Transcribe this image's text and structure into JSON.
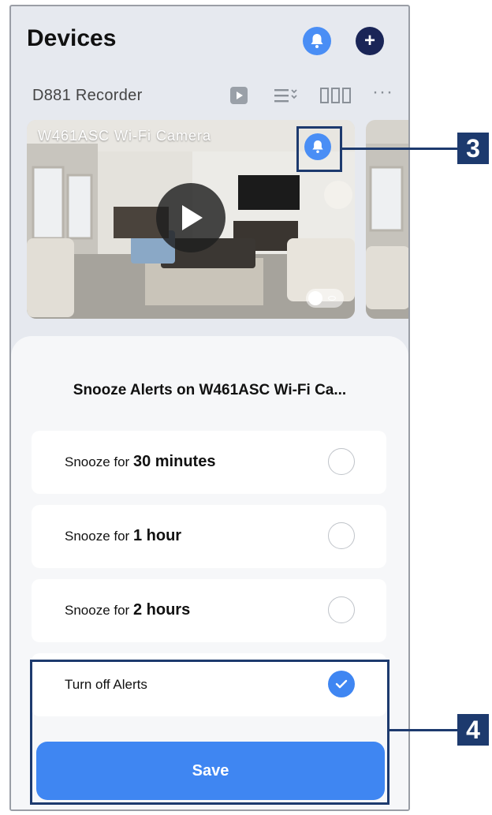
{
  "header": {
    "title": "Devices",
    "add_symbol": "+"
  },
  "recorder": {
    "name": "D881 Recorder",
    "icons": [
      "play-icon",
      "list-view-icon",
      "grid-view-icon",
      "more-icon"
    ],
    "more_glyph": "···"
  },
  "camera": {
    "name": "W461ASC Wi-Fi Camera"
  },
  "sheet": {
    "title": "Snooze Alerts on W461ASC Wi-Fi Ca...",
    "options": [
      {
        "prefix": "Snooze for ",
        "value": "30 minutes",
        "checked": false
      },
      {
        "prefix": "Snooze for ",
        "value": "1 hour",
        "checked": false
      },
      {
        "prefix": "Snooze for ",
        "value": "2 hours",
        "checked": false
      },
      {
        "prefix": "Turn off Alerts",
        "value": "",
        "checked": true
      }
    ],
    "save_label": "Save"
  },
  "callouts": {
    "bell": "3",
    "save_section": "4"
  },
  "colors": {
    "accent": "#3f86f2",
    "navy": "#1a2557",
    "callout": "#1d3a6e"
  }
}
